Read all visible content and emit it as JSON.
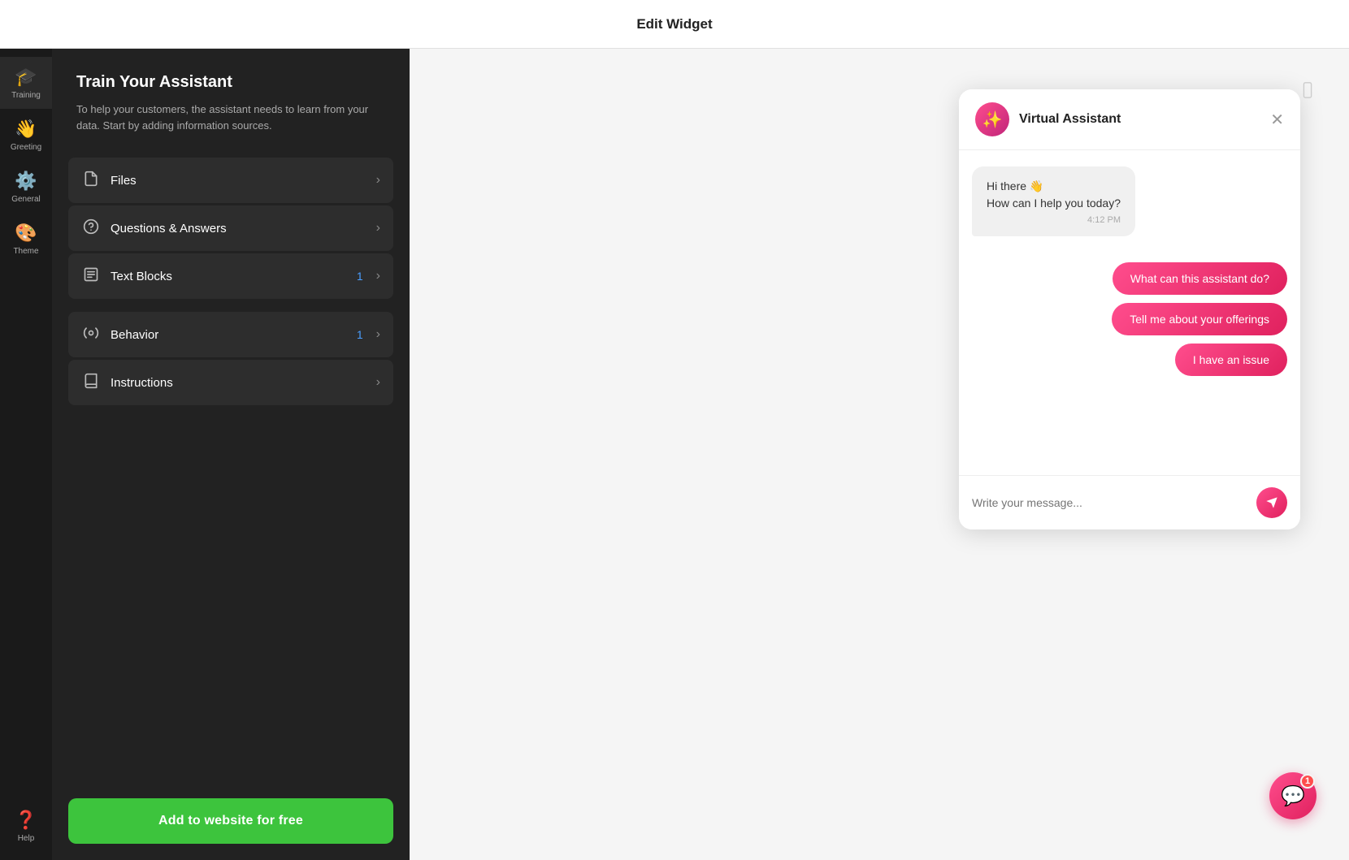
{
  "topBar": {
    "title": "Edit Widget"
  },
  "iconSidebar": {
    "items": [
      {
        "id": "training",
        "icon": "🎓",
        "label": "Training",
        "active": true
      },
      {
        "id": "greeting",
        "icon": "👋",
        "label": "Greeting",
        "active": false
      },
      {
        "id": "general",
        "icon": "⚙️",
        "label": "General",
        "active": false
      },
      {
        "id": "theme",
        "icon": "🎨",
        "label": "Theme",
        "active": false
      },
      {
        "id": "help",
        "icon": "❓",
        "label": "Help",
        "active": false
      }
    ]
  },
  "trainingPanel": {
    "title": "Train Your Assistant",
    "subtitle": "To help your customers, the assistant needs to learn from your data. Start by adding information sources.",
    "groups": [
      {
        "items": [
          {
            "id": "files",
            "icon": "📄",
            "label": "Files",
            "badge": "",
            "hasChevron": true
          },
          {
            "id": "qa",
            "icon": "❓",
            "label": "Questions & Answers",
            "badge": "",
            "hasChevron": true
          },
          {
            "id": "textblocks",
            "icon": "📝",
            "label": "Text Blocks",
            "badge": "1",
            "hasChevron": true
          }
        ]
      },
      {
        "items": [
          {
            "id": "behavior",
            "icon": "🎯",
            "label": "Behavior",
            "badge": "1",
            "hasChevron": true
          },
          {
            "id": "instructions",
            "icon": "📖",
            "label": "Instructions",
            "badge": "",
            "hasChevron": true
          }
        ]
      }
    ],
    "addButton": "Add to website for free"
  },
  "chatWidget": {
    "header": {
      "name": "Virtual Assistant",
      "avatarIcon": "✨"
    },
    "messages": [
      {
        "type": "bot",
        "text": "Hi there 👋\nHow can I help you today?",
        "time": "4:12 PM"
      }
    ],
    "suggestions": [
      {
        "id": "s1",
        "label": "What can this assistant do?"
      },
      {
        "id": "s2",
        "label": "Tell me about your offerings"
      },
      {
        "id": "s3",
        "label": "I have an issue"
      }
    ],
    "inputPlaceholder": "Write your message...",
    "floatingBadge": "1"
  }
}
